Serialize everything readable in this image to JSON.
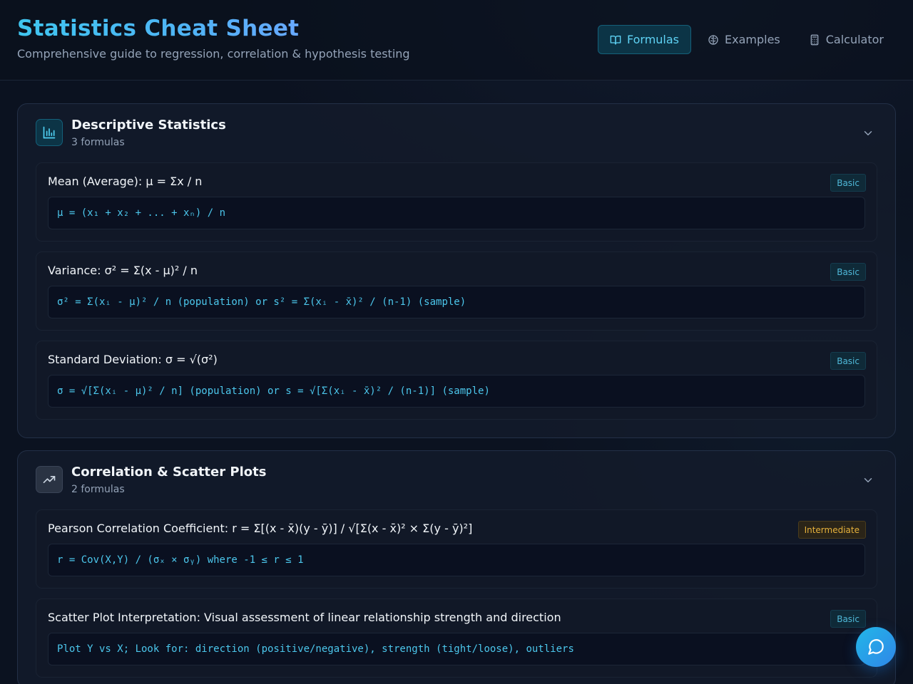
{
  "header": {
    "title": "Statistics Cheat Sheet",
    "subtitle": "Comprehensive guide to regression, correlation & hypothesis testing",
    "nav": [
      {
        "label": "Formulas",
        "icon": "book-open-icon",
        "active": true
      },
      {
        "label": "Examples",
        "icon": "brain-icon",
        "active": false
      },
      {
        "label": "Calculator",
        "icon": "calculator-icon",
        "active": false
      }
    ]
  },
  "sections": [
    {
      "title": "Descriptive Statistics",
      "count": "3 formulas",
      "icon": "bar-chart-icon",
      "cards": [
        {
          "title": "Mean (Average): μ = Σx / n",
          "level": "Basic",
          "formula": "μ = (x₁ + x₂ + ... + xₙ) / n"
        },
        {
          "title": "Variance: σ² = Σ(x - μ)² / n",
          "level": "Basic",
          "formula": "σ² = Σ(xᵢ - μ)² / n (population) or s² = Σ(xᵢ - x̄)² / (n-1) (sample)"
        },
        {
          "title": "Standard Deviation: σ = √(σ²)",
          "level": "Basic",
          "formula": "σ = √[Σ(xᵢ - μ)² / n] (population) or s = √[Σ(xᵢ - x̄)² / (n-1)] (sample)"
        }
      ]
    },
    {
      "title": "Correlation & Scatter Plots",
      "count": "2 formulas",
      "icon": "trending-up-icon",
      "cards": [
        {
          "title": "Pearson Correlation Coefficient: r = Σ[(x - x̄)(y - ȳ)] / √[Σ(x - x̄)² × Σ(y - ȳ)²]",
          "level": "Intermediate",
          "formula": "r = Cov(X,Y) / (σₓ × σᵧ) where -1 ≤ r ≤ 1"
        },
        {
          "title": "Scatter Plot Interpretation: Visual assessment of linear relationship strength and direction",
          "level": "Basic",
          "formula": "Plot Y vs X; Look for: direction (positive/negative), strength (tight/loose), outliers"
        }
      ]
    }
  ],
  "colors": {
    "accent": "#4fd0f3",
    "badge_basic": "#4fb8d8",
    "badge_intermediate": "#e7b23c"
  },
  "chat_icon": "message-circle-icon"
}
